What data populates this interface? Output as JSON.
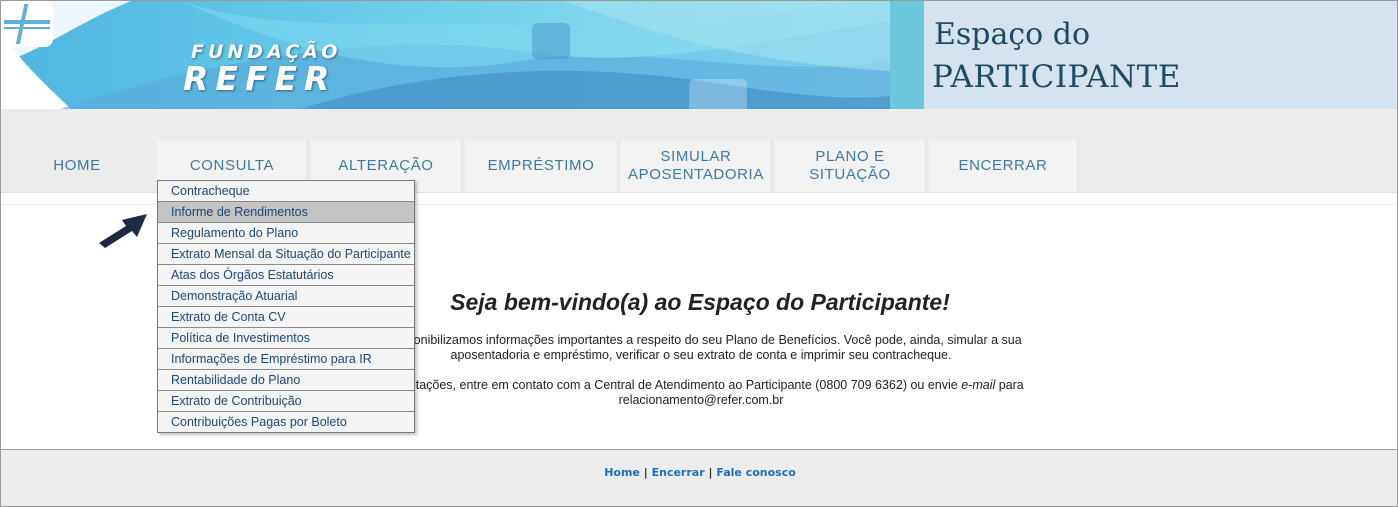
{
  "header": {
    "logo_top": "FUNDAÇÃO",
    "logo_bottom": "REFER",
    "title_line1": "Espaço do",
    "title_line2": "PARTICIPANTE"
  },
  "nav": {
    "items": [
      {
        "label": "HOME"
      },
      {
        "label": "CONSULTA"
      },
      {
        "label": "ALTERAÇÃO"
      },
      {
        "label": "EMPRÉSTIMO"
      },
      {
        "label": "SIMULAR\nAPOSENTADORIA"
      },
      {
        "label": "PLANO E\nSITUAÇÃO"
      },
      {
        "label": "ENCERRAR"
      }
    ]
  },
  "dropdown": {
    "items": [
      "Contracheque",
      "Informe de Rendimentos",
      "Regulamento do Plano",
      "Extrato Mensal da Situação do Participante",
      "Atas dos Órgãos Estatutários",
      "Demonstração Atuarial",
      "Extrato de Conta CV",
      "Política de Investimentos",
      "Informações de Empréstimo para IR",
      "Rentabilidade do Plano",
      "Extrato de Contribuição",
      "Contribuições Pagas por Boleto"
    ],
    "highlighted": "Informe de Rendimentos"
  },
  "main": {
    "welcome": "Seja bem-vindo(a) ao Espaço do Participante!",
    "para1_line1": "o disponibilizamos informações importantes a respeito do seu Plano de Benefícios. Você pode, ainda, simular a sua",
    "para1_line2": "aposentadoria e empréstimo, verificar o seu extrato de conta e imprimir seu contracheque.",
    "para2_line1_a": "s solicitações, entre em contato com a Central de Atendimento ao Participante (0800 709 6362) ou envie ",
    "para2_line1_em": "e-mail",
    "para2_line1_b": " para",
    "para2_line2": "relacionamento@refer.com.br"
  },
  "footer": {
    "links": [
      "Home",
      "Encerrar",
      "Fale conosco"
    ],
    "separator": "|"
  },
  "colors": {
    "accent": "#3c7ba3",
    "title": "#1c4b66",
    "panel": "#d5e3ee",
    "link": "#1a6fc0",
    "arrow": "#1b2a45"
  }
}
